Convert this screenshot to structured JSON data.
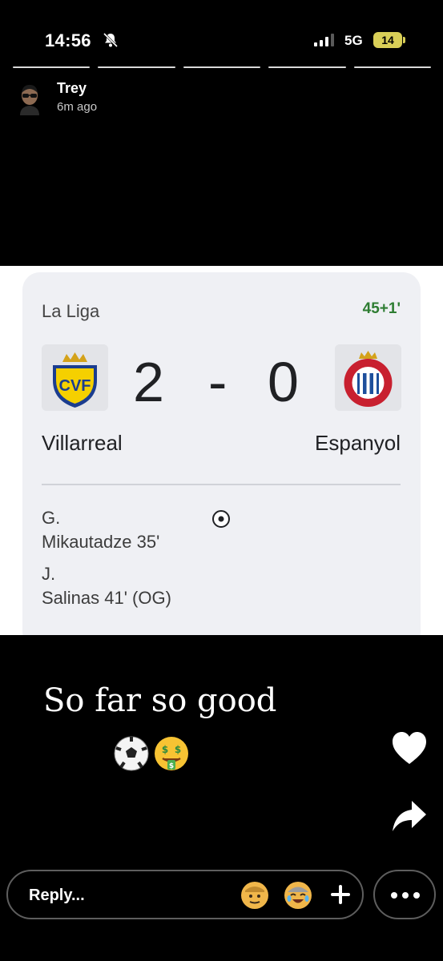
{
  "status_bar": {
    "time": "14:56",
    "network": "5G",
    "battery": "14",
    "silent_icon": "bell-slash-icon",
    "signal_icon": "signal-bars-icon",
    "battery_color": "#d9cf57"
  },
  "story": {
    "segments": 5,
    "author": {
      "name": "Trey",
      "time": "6m ago",
      "avatar_icon": "bitmoji-avatar-icon"
    }
  },
  "match_card": {
    "league": "La Liga",
    "minute": "45+1'",
    "home_team": "Villarreal",
    "away_team": "Espanyol",
    "home_score": "2",
    "separator": "-",
    "away_score": "0",
    "home_crest": "villarreal-crest-icon",
    "away_crest": "espanyol-crest-icon",
    "goals": [
      {
        "line1": "G.",
        "line2": "Mikautadze 35'"
      },
      {
        "line1": "J.",
        "line2": "Salinas 41' (OG)"
      }
    ],
    "goal_icon": "soccer-ball-icon",
    "minute_color": "#2e7d32"
  },
  "caption": {
    "text": "So far so good",
    "emojis": [
      "soccer-ball-emoji",
      "money-mouth-face-emoji"
    ]
  },
  "actions": {
    "like_icon": "heart-icon",
    "share_icon": "share-arrow-icon"
  },
  "reply_bar": {
    "placeholder": "Reply...",
    "reaction_avatars": [
      "saluting-bitmoji-icon",
      "laughing-crying-bitmoji-icon"
    ],
    "add_icon": "plus-icon",
    "more_icon": "more-dots-icon"
  }
}
